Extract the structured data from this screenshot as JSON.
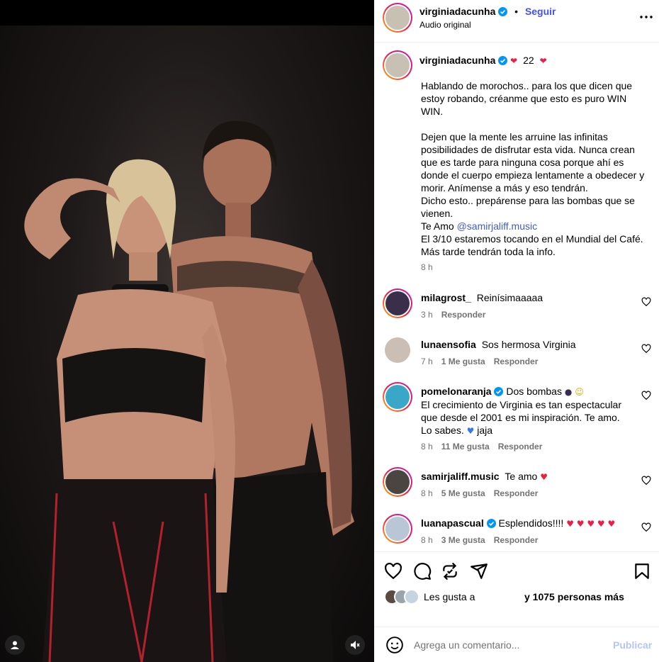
{
  "media": {
    "user_icon": "user-tag-icon",
    "mute_icon": "speaker-muted-icon"
  },
  "header": {
    "username": "virginiadacunha",
    "separator": "•",
    "follow_label": "Seguir",
    "subtitle": "Audio original",
    "more_icon": "more-horizontal-icon"
  },
  "caption": {
    "username": "virginiadacunha",
    "badge": "22",
    "text_1": "Hablando de morochos.. para los que dicen que estoy robando, créanme que esto es puro WIN WIN.\n\nDejen que la mente les arruine las infinitas posibilidades de disfrutar esta vida. Nunca crean que es tarde para ninguna cosa porque ahí es donde el cuerpo empieza lentamente a obedecer y morir. Anímense a más y eso tendrán.\nDicho esto.. prepárense para las bombas que se vienen.\nTe Amo ",
    "mention": "@samirjaliff.music",
    "text_2": "\nEl 3/10 estaremos tocando en el Mundial del Café. Más tarde tendrán toda la info.",
    "time": "8 h"
  },
  "comments": [
    {
      "username": "milagrost_",
      "text": "Reinísimaaaaa",
      "time": "3 h",
      "likes": "",
      "reply": "Responder"
    },
    {
      "username": "lunaensofia",
      "text": "Sos hermosa Virginia",
      "time": "7 h",
      "likes": "1 Me gusta",
      "reply": "Responder"
    },
    {
      "username": "pomelonaranja",
      "text": "Dos bombas",
      "text_2": "El crecimiento de Virginia es tan espectacular que desde el 2001 es mi inspiración. Te amo. Lo sabes.",
      "text_3": "jaja",
      "time": "8 h",
      "likes": "11 Me gusta",
      "reply": "Responder"
    },
    {
      "username": "samirjaliff.music",
      "text": "Te amo",
      "time": "8 h",
      "likes": "5 Me gusta",
      "reply": "Responder"
    },
    {
      "username": "luanapascual",
      "text": "Esplendidos!!!!",
      "time": "8 h",
      "likes": "3 Me gusta",
      "reply": "Responder"
    }
  ],
  "actions": {
    "like_icon": "heart-icon",
    "comment_icon": "comment-icon",
    "repost_icon": "repost-icon",
    "share_icon": "share-icon",
    "save_icon": "bookmark-icon",
    "likes_prefix": "Les gusta a",
    "likes_suffix": "y 1075 personas más"
  },
  "comment_bar": {
    "emoji_icon": "emoji-icon",
    "placeholder": "Agrega un comentario...",
    "publish_label": "Publicar"
  },
  "colors": {
    "accent": "#4150f7",
    "verified": "#0095f6",
    "muted": "#737373",
    "heart": "#ed1d46"
  }
}
